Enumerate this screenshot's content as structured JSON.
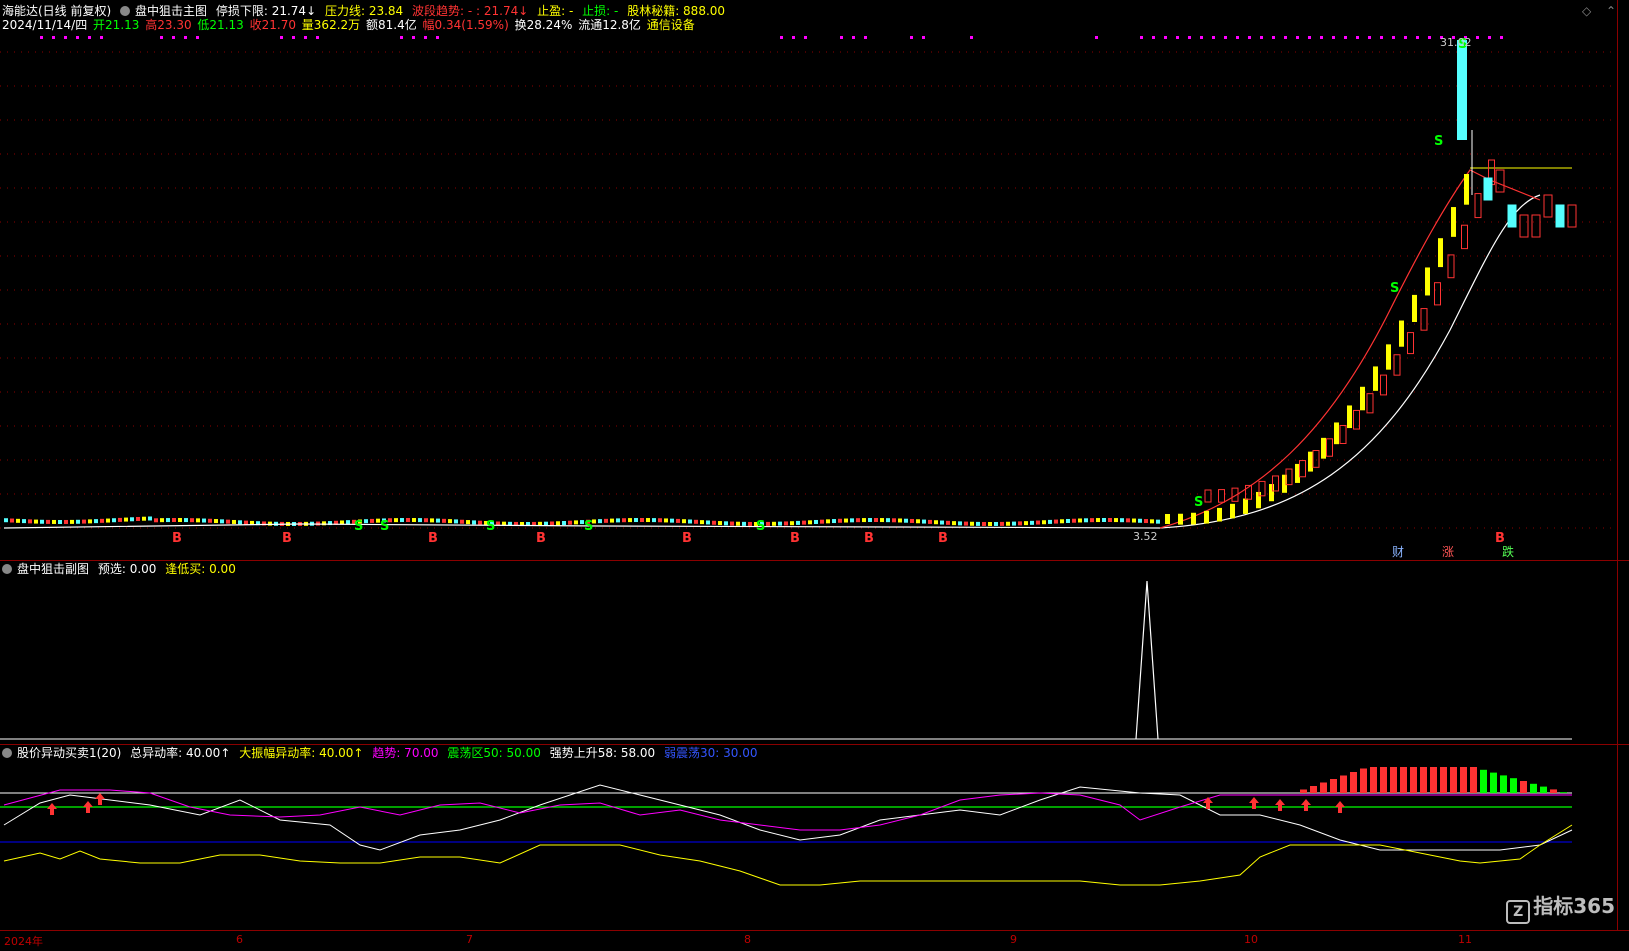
{
  "main": {
    "stock": "海能达(日线 前复权)",
    "indicator": "盘中狙击主图",
    "stop_loss_floor": "停损下限: 21.74↓",
    "pressure": "压力线: 23.84",
    "trend": "波段趋势: - : 21.74↓",
    "take_profit": "止盈: -",
    "stop_loss": "止损: -",
    "secret": "股林秘籍: 888.00",
    "date": "2024/11/14/四",
    "open": "开21.13",
    "high": "高23.30",
    "low": "低21.13",
    "close": "收21.70",
    "volume": "量362.2万",
    "amount": "额81.4亿",
    "change": "幅0.34(1.59%)",
    "turnover": "换28.24%",
    "float": "流通12.8亿",
    "sector": "通信设备",
    "peak_label": "31.02",
    "low_label": "3.52",
    "event_cai": "财",
    "event_zhang": "涨",
    "event_die": "跌"
  },
  "sub": {
    "indicator": "盘中狙击副图",
    "preselect": "预选: 0.00",
    "buy_low": "逢低买: 0.00"
  },
  "ind": {
    "name": "股价异动买卖1(20)",
    "total": "总异动率: 40.00↑",
    "big": "大振幅异动率: 40.00↑",
    "trend": "趋势: 70.00",
    "zone": "震荡区50: 50.00",
    "strong": "强势上升58: 58.00",
    "weak": "弱震荡30: 30.00"
  },
  "axis": {
    "labels": [
      "2024年",
      "6",
      "7",
      "8",
      "9",
      "10",
      "11"
    ]
  },
  "watermark": "指标365",
  "colors": {
    "up": "#ff3333",
    "down": "#55ffff",
    "yellow": "#ffff00",
    "magenta": "#ff00ff",
    "green": "#00ff00",
    "blue": "#0000ff",
    "grid": "#8b0000"
  },
  "icons": {
    "collapse": "circle-icon",
    "diamond": "diamond-icon",
    "up_arrow": "up-arrow-icon"
  }
}
